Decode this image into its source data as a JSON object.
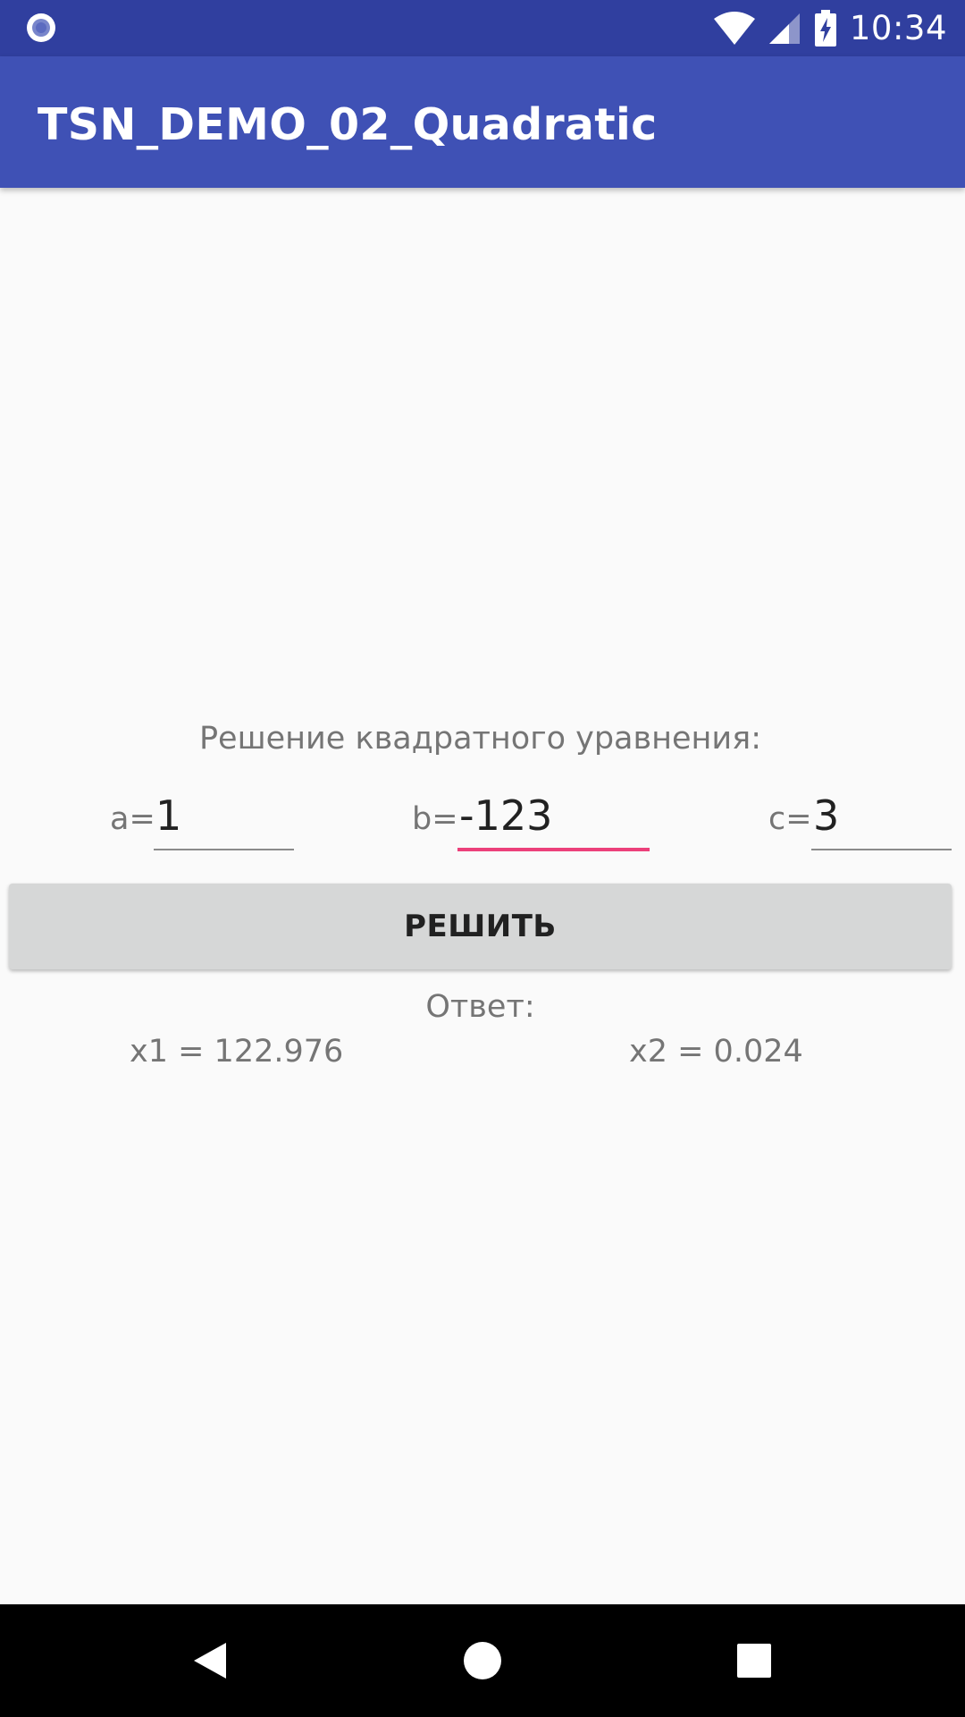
{
  "status_bar": {
    "time": "10:34",
    "icons": [
      "notification-dot-icon",
      "wifi-icon",
      "cell-signal-icon",
      "battery-charging-icon"
    ]
  },
  "app_bar": {
    "title": "TSN_DEMO_02_Quadratic"
  },
  "form": {
    "heading": "Решение квадратного уравнения:",
    "a": {
      "label": "a=",
      "value": "1"
    },
    "b": {
      "label": "b=",
      "value": "-123",
      "focused": true
    },
    "c": {
      "label": "c=",
      "value": "3"
    },
    "solve_label": "РЕШИТЬ"
  },
  "result": {
    "label": "Ответ:",
    "x1": "x1 = 122.976",
    "x2": "x2 = 0.024"
  },
  "colors": {
    "status_bar": "#303f9f",
    "app_bar": "#3f51b5",
    "accent": "#ec407a",
    "button": "#d6d7d7",
    "background": "#fafafa"
  },
  "nav_bar": {
    "icons": [
      "back-icon",
      "home-icon",
      "recents-icon"
    ]
  }
}
